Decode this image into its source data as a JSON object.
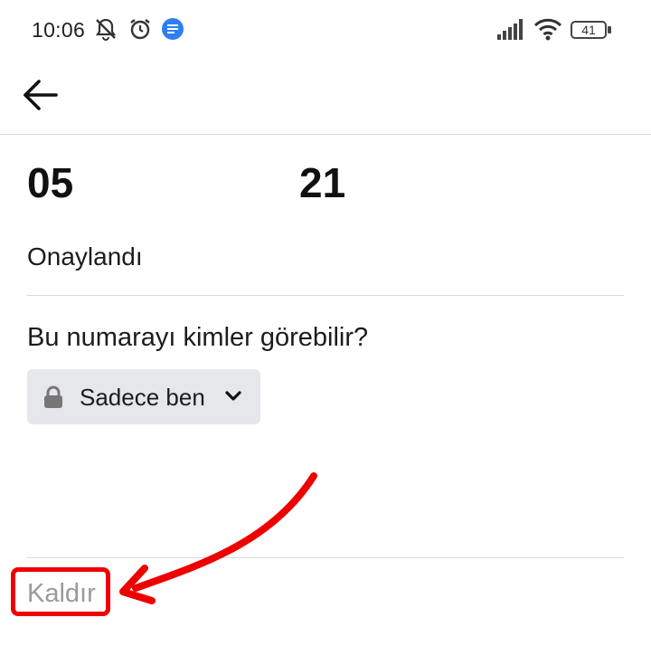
{
  "status_bar": {
    "time": "10:06",
    "battery": "41",
    "icons": [
      "silent-notification-icon",
      "alarm-icon",
      "message-notification-icon",
      "signal-icon",
      "wifi-icon",
      "battery-icon"
    ]
  },
  "header": {
    "back_icon": "back-arrow-icon"
  },
  "phone": {
    "part1": "05",
    "part2": "21"
  },
  "status": {
    "label": "Onaylandı"
  },
  "privacy": {
    "question": "Bu numarayı kimler görebilir?",
    "selected": "Sadece ben",
    "icon": "lock-icon"
  },
  "actions": {
    "remove_label": "Kaldır"
  },
  "colors": {
    "annotation_red": "#ee0000",
    "privacy_bg": "#e5e7eb",
    "remove_text": "#9a9a9a"
  }
}
